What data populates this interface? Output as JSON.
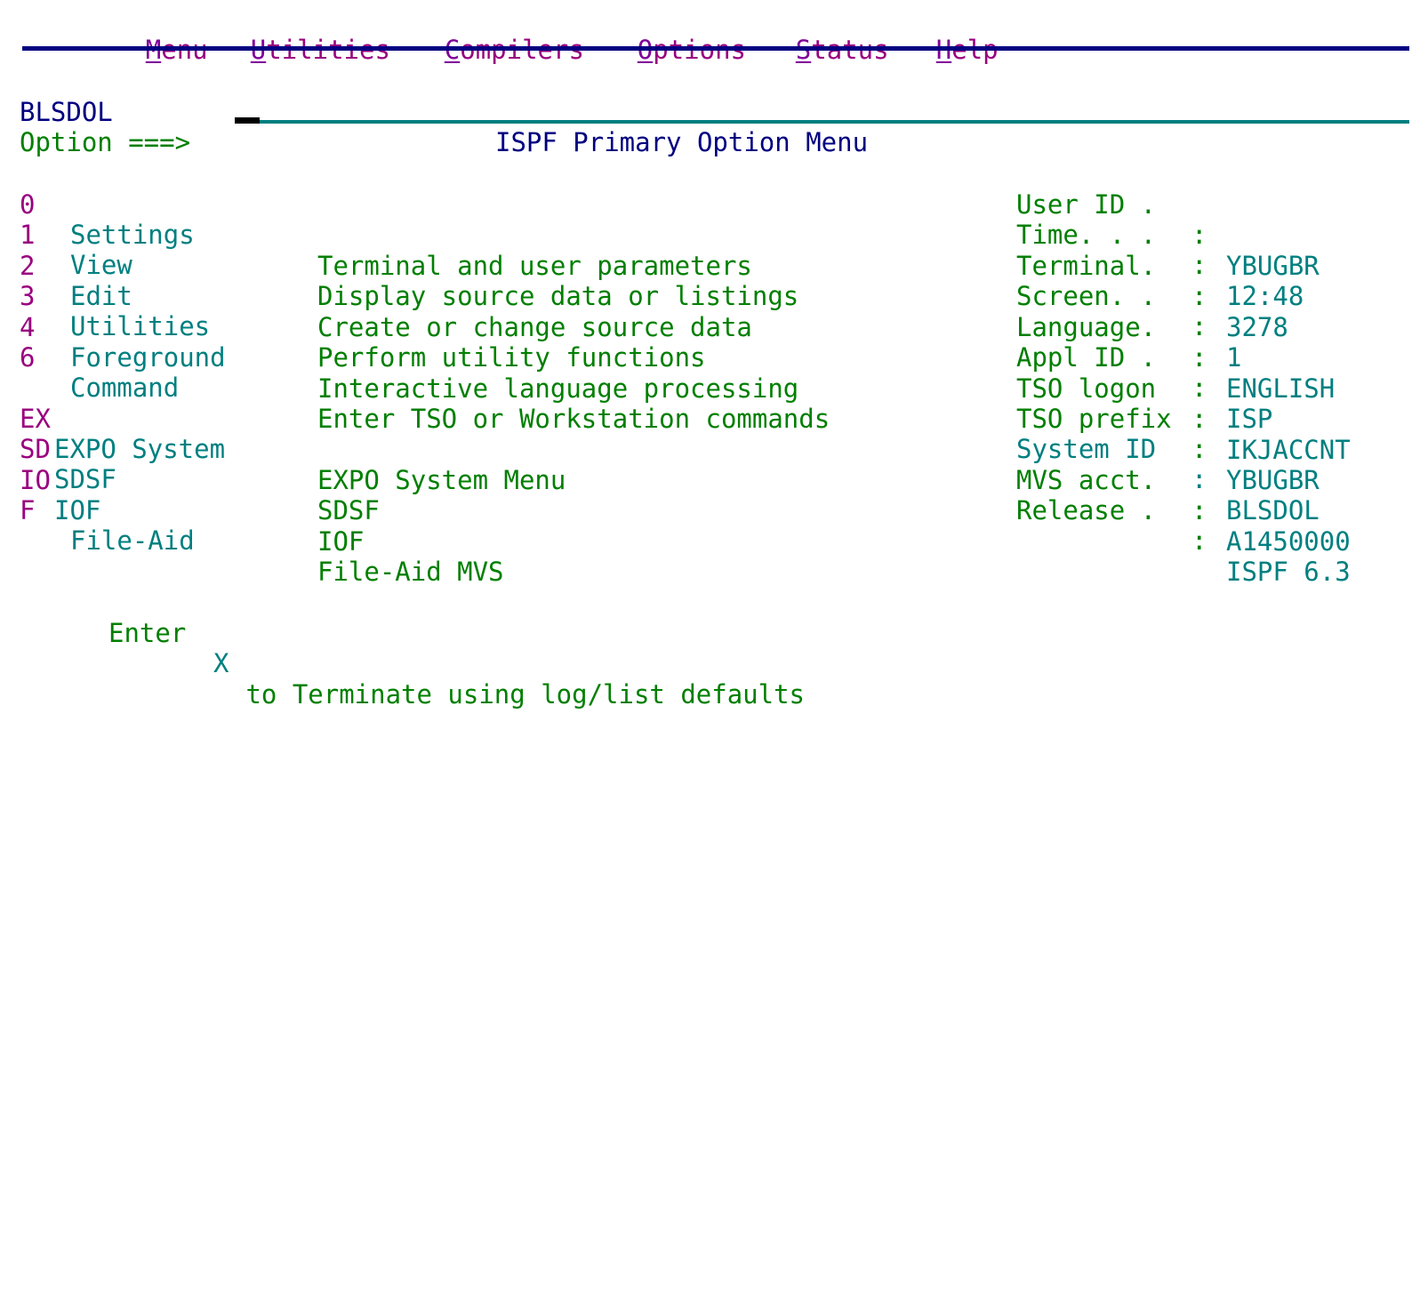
{
  "screen": {
    "rows": 21,
    "cols": 80,
    "bg_color": "#ffffff",
    "colors": {
      "navy": "#000080",
      "green": "#007f00",
      "turquoise": "#007f80",
      "magenta": "#99007f",
      "purple_mnemonic": "#7f0099",
      "cursor": "#000000"
    }
  },
  "action_bar": {
    "items": [
      {
        "label": "Menu",
        "mnemonic": "M"
      },
      {
        "label": "Utilities",
        "mnemonic": "U"
      },
      {
        "label": "Compilers",
        "mnemonic": "C"
      },
      {
        "label": "Options",
        "mnemonic": "O"
      },
      {
        "label": "Status",
        "mnemonic": "S"
      },
      {
        "label": "Help",
        "mnemonic": "H"
      }
    ]
  },
  "header": {
    "screen_id": "BLSDOL",
    "title": "ISPF Primary Option Menu"
  },
  "command_line": {
    "prompt": "Option ===>",
    "value": "",
    "placeholder": ""
  },
  "primary_options": [
    {
      "code": "0",
      "name": "Settings",
      "description": "Terminal and user parameters"
    },
    {
      "code": "1",
      "name": "View",
      "description": "Display source data or listings"
    },
    {
      "code": "2",
      "name": "Edit",
      "description": "Create or change source data"
    },
    {
      "code": "3",
      "name": "Utilities",
      "description": "Perform utility functions"
    },
    {
      "code": "4",
      "name": "Foreground",
      "description": "Interactive language processing"
    },
    {
      "code": "6",
      "name": "Command",
      "description": "Enter TSO or Workstation commands"
    }
  ],
  "site_options": [
    {
      "code": "EX",
      "name": "EXPO System",
      "description": "EXPO System Menu"
    },
    {
      "code": "SD",
      "name": "SDSF",
      "description": "SDSF"
    },
    {
      "code": "IO",
      "name": "IOF",
      "description": "IOF"
    },
    {
      "code": "F",
      "name": "File-Aid",
      "description": "File-Aid MVS"
    }
  ],
  "info_panel": [
    {
      "label": "User ID .",
      "separator": ":",
      "value": "YBUGBR",
      "label_color": "green"
    },
    {
      "label": "Time. . .",
      "separator": ":",
      "value": "12:48",
      "label_color": "green"
    },
    {
      "label": "Terminal.",
      "separator": ":",
      "value": "3278",
      "label_color": "green"
    },
    {
      "label": "Screen. .",
      "separator": ":",
      "value": "1",
      "label_color": "green"
    },
    {
      "label": "Language.",
      "separator": ":",
      "value": "ENGLISH",
      "label_color": "green"
    },
    {
      "label": "Appl ID .",
      "separator": ":",
      "value": "ISP",
      "label_color": "green"
    },
    {
      "label": "TSO logon",
      "separator": ":",
      "value": "IKJACCNT",
      "label_color": "green"
    },
    {
      "label": "TSO prefix",
      "separator": ":",
      "value": "YBUGBR",
      "label_color": "green"
    },
    {
      "label": "System ID",
      "separator": ":",
      "value": "BLSDOL",
      "label_color": "turquoise"
    },
    {
      "label": "MVS acct.",
      "separator": ":",
      "value": "A1450000",
      "label_color": "green"
    },
    {
      "label": "Release .",
      "separator": ":",
      "value": "ISPF 6.3",
      "label_color": "green"
    }
  ],
  "footer": {
    "message_prefix": "Enter ",
    "message_key": "X",
    "message_suffix": " to Terminate using log/list defaults"
  }
}
